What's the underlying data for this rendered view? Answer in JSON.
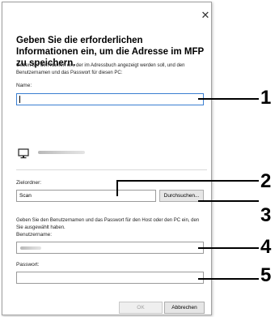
{
  "dialog": {
    "close_glyph": "✕",
    "heading": "Geben Sie die erforderlichen Informationen ein, um die Adresse im MFP zu speichern.",
    "description": "Geben Sie den Namen ein, der im Adressbuch angezeigt werden soll, und den Benutzernamen und das Passwort für diesen PC:",
    "name_label": "Name:",
    "name_value": "",
    "pc_icon": "monitor-icon",
    "target_folder_label": "Zielordner:",
    "target_folder_value": "Scan",
    "browse_button": "Durchsuchen...",
    "credentials_description": "Geben Sie den Benutzernamen und das Passwort für den Host oder den PC ein, den Sie ausgewählt haben.",
    "username_label": "Benutzername:",
    "password_label": "Passwort:",
    "password_value": "",
    "ok_button": "OK",
    "cancel_button": "Abbrechen"
  },
  "callouts": [
    "1",
    "2",
    "3",
    "4",
    "5"
  ],
  "colors": {
    "focus_border": "#3b7fd1",
    "field_border": "#9a9a9a",
    "button_face": "#e6e6e6"
  }
}
